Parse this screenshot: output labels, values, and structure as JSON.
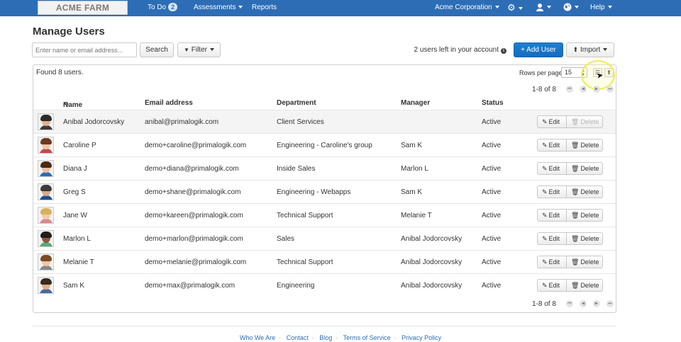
{
  "nav": {
    "logo": "ACME FARM SUPPLY",
    "todo_label": "To Do",
    "todo_count": "2",
    "assessments_label": "Assessments",
    "reports_label": "Reports",
    "org_label": "Acme Corporation",
    "help_label": "Help"
  },
  "page": {
    "title": "Manage Users",
    "search_placeholder": "Enter name or email address...",
    "search_button": "Search",
    "filter_button": "Filter",
    "users_left": "2 users left in your account",
    "add_user_button": "+ Add User",
    "import_button": "Import"
  },
  "panel": {
    "found_text": "Found 8 users.",
    "rows_per_page_label": "Rows per page",
    "rows_per_page_value": "15",
    "pager_text": "1-8 of 8"
  },
  "table": {
    "headers": [
      "Name",
      "Email address",
      "Department",
      "Manager",
      "Status"
    ],
    "edit_label": "Edit",
    "delete_label": "Delete",
    "rows": [
      {
        "name": "Anibal Jodorcovsky",
        "email": "anibal@primalogik.com",
        "department": "Client Services",
        "manager": "",
        "status": "Active"
      },
      {
        "name": "Caroline P",
        "email": "demo+caroline@primalogik.com",
        "department": "Engineering - Caroline's group",
        "manager": "Sam K",
        "status": "Active"
      },
      {
        "name": "Diana J",
        "email": "demo+diana@primalogik.com",
        "department": "Inside Sales",
        "manager": "Marlon L",
        "status": "Active"
      },
      {
        "name": "Greg S",
        "email": "demo+shane@primalogik.com",
        "department": "Engineering - Webapps",
        "manager": "Sam K",
        "status": "Active"
      },
      {
        "name": "Jane W",
        "email": "demo+kareen@primalogik.com",
        "department": "Technical Support",
        "manager": "Melanie T",
        "status": "Active"
      },
      {
        "name": "Marlon L",
        "email": "demo+marlon@primalogik.com",
        "department": "Sales",
        "manager": "Anibal Jodorcovsky",
        "status": "Active"
      },
      {
        "name": "Melanie T",
        "email": "demo+melanie@primalogik.com",
        "department": "Technical Support",
        "manager": "Anibal Jodorcovsky",
        "status": "Active"
      },
      {
        "name": "Sam K",
        "email": "demo+max@primalogik.com",
        "department": "Engineering",
        "manager": "Anibal Jodorcovsky",
        "status": "Active"
      }
    ]
  },
  "footer": {
    "links": [
      "Who We Are",
      "Contact",
      "Blog",
      "Terms of Service",
      "Privacy Policy"
    ]
  },
  "colors": {
    "nav_bg": "#2d6db5",
    "primary": "#1a76c9",
    "highlight": "#f1ee4a"
  }
}
